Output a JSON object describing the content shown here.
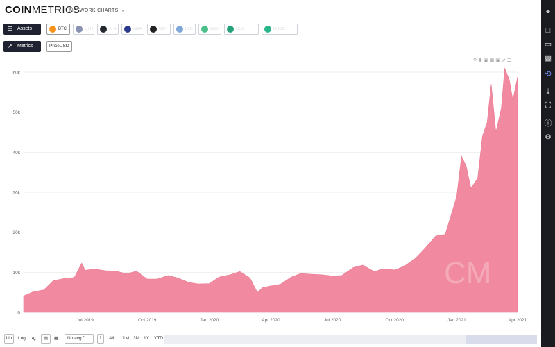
{
  "header": {
    "logo_bold": "COIN",
    "logo_light": "METRICS",
    "nav_label": "NETWORK CHARTS"
  },
  "assets_button": "Assets",
  "metrics_button": "Metrics",
  "assets": [
    {
      "label": "BTC",
      "color": "#f7931a",
      "selected": true
    },
    {
      "label": "ETH",
      "color": "#8a92b2",
      "selected": false
    },
    {
      "label": "XRP",
      "color": "#23292f",
      "selected": false
    },
    {
      "label": "ADA",
      "color": "#2a3a8f",
      "selected": false
    },
    {
      "label": "DOT",
      "color": "#222222",
      "selected": false
    },
    {
      "label": "LTC",
      "color": "#7fa8d8",
      "selected": false
    },
    {
      "label": "BCH",
      "color": "#4bbf8a",
      "selected": false
    },
    {
      "label": "USDT",
      "color": "#26a17b",
      "selected": false
    },
    {
      "label": "USDC",
      "color": "#2bb58a",
      "selected": false
    }
  ],
  "metric_selected": "PriceUSD",
  "chart_data": {
    "type": "area",
    "series": [
      {
        "name": "PriceUSD",
        "color": "#f18aa0",
        "x": [
          "2019-04-01",
          "2019-04-15",
          "2019-05-01",
          "2019-05-15",
          "2019-06-01",
          "2019-06-15",
          "2019-06-26",
          "2019-07-01",
          "2019-07-15",
          "2019-08-01",
          "2019-08-15",
          "2019-09-01",
          "2019-09-15",
          "2019-10-01",
          "2019-10-15",
          "2019-11-01",
          "2019-11-15",
          "2019-12-01",
          "2019-12-15",
          "2020-01-01",
          "2020-01-15",
          "2020-02-01",
          "2020-02-15",
          "2020-03-01",
          "2020-03-12",
          "2020-03-20",
          "2020-04-01",
          "2020-04-15",
          "2020-05-01",
          "2020-05-15",
          "2020-06-01",
          "2020-06-15",
          "2020-07-01",
          "2020-07-15",
          "2020-08-01",
          "2020-08-15",
          "2020-09-01",
          "2020-09-15",
          "2020-10-01",
          "2020-10-15",
          "2020-11-01",
          "2020-11-15",
          "2020-12-01",
          "2020-12-15",
          "2021-01-01",
          "2021-01-08",
          "2021-01-15",
          "2021-01-22",
          "2021-02-01",
          "2021-02-08",
          "2021-02-15",
          "2021-02-21",
          "2021-02-28",
          "2021-03-08",
          "2021-03-13",
          "2021-03-20",
          "2021-03-25",
          "2021-04-01"
        ],
        "values": [
          4100,
          5100,
          5600,
          7900,
          8500,
          8700,
          12300,
          10500,
          10800,
          10400,
          10300,
          9600,
          10300,
          8300,
          8300,
          9200,
          8600,
          7500,
          7100,
          7200,
          8800,
          9400,
          10200,
          8600,
          5000,
          6200,
          6600,
          7000,
          8800,
          9700,
          9500,
          9400,
          9100,
          9200,
          11200,
          11800,
          10200,
          10900,
          10600,
          11500,
          13500,
          16000,
          19100,
          19500,
          29000,
          39000,
          36500,
          31000,
          33500,
          44000,
          47500,
          57000,
          45000,
          51000,
          61000,
          58000,
          53000,
          58800
        ]
      }
    ],
    "y_ticks": [
      "0",
      "10k",
      "20k",
      "30k",
      "40k",
      "50k",
      "60k"
    ],
    "x_ticks": [
      "Jul 2019",
      "Oct 2019",
      "Jan 2020",
      "Apr 2020",
      "Jul 2020",
      "Oct 2020",
      "Jan 2021",
      "Apr 2021"
    ],
    "x_tick_dates": [
      "2019-07-01",
      "2019-10-01",
      "2020-01-01",
      "2020-04-01",
      "2020-07-01",
      "2020-10-01",
      "2021-01-01",
      "2021-04-01"
    ],
    "x_range": [
      "2019-04-01",
      "2021-04-01"
    ],
    "ylim": [
      0,
      60000
    ],
    "grid": true,
    "watermark": "CM"
  },
  "bottom": {
    "lin": "Lin",
    "log": "Log",
    "avg": "No avg",
    "ranges": [
      "All",
      "1M",
      "3M",
      "1Y",
      "YTD"
    ]
  }
}
